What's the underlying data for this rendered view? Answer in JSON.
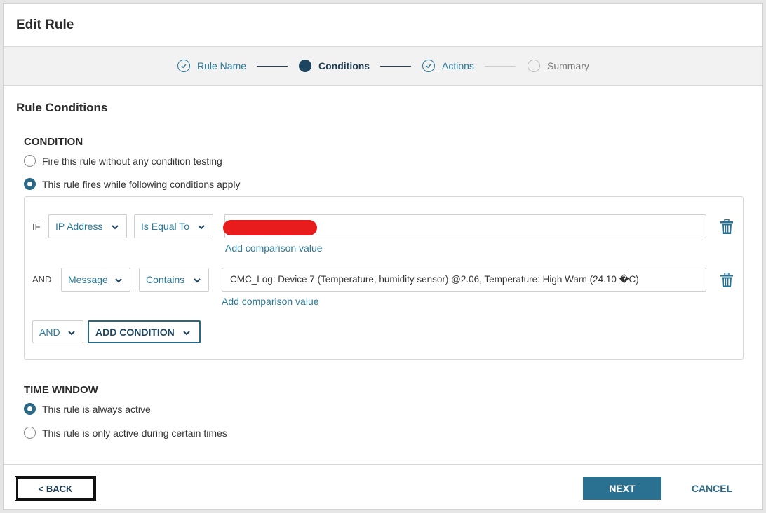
{
  "dialog": {
    "title": "Edit Rule"
  },
  "stepper": {
    "steps": [
      {
        "label": "Rule Name",
        "state": "done"
      },
      {
        "label": "Conditions",
        "state": "current"
      },
      {
        "label": "Actions",
        "state": "done"
      },
      {
        "label": "Summary",
        "state": "todo"
      }
    ]
  },
  "section": {
    "title": "Rule Conditions"
  },
  "condition": {
    "heading": "CONDITION",
    "options": [
      {
        "label": "Fire this rule without any condition testing",
        "checked": false
      },
      {
        "label": "This rule fires while following conditions apply",
        "checked": true
      }
    ],
    "rows": [
      {
        "keyword": "IF",
        "field": "IP Address",
        "operator": "Is Equal To",
        "value": "",
        "add_value_label": "Add comparison value"
      },
      {
        "keyword": "AND",
        "field": "Message",
        "operator": "Contains",
        "value": "CMC_Log: Device 7 (Temperature, humidity sensor) @2.06, Temperature: High Warn (24.10 �C)",
        "add_value_label": "Add comparison value"
      }
    ],
    "logic_select": "AND",
    "add_condition_label": "ADD CONDITION"
  },
  "time_window": {
    "heading": "TIME WINDOW",
    "options": [
      {
        "label": "This rule is always active",
        "checked": true
      },
      {
        "label": "This rule is only active during certain times",
        "checked": false
      }
    ]
  },
  "footer": {
    "back_label": "< BACK",
    "next_label": "NEXT",
    "cancel_label": "CANCEL"
  },
  "colors": {
    "accent": "#2a7a9a",
    "primary_button": "#2a7090",
    "current_step": "#1d4560",
    "redaction": "#e81c1c"
  }
}
